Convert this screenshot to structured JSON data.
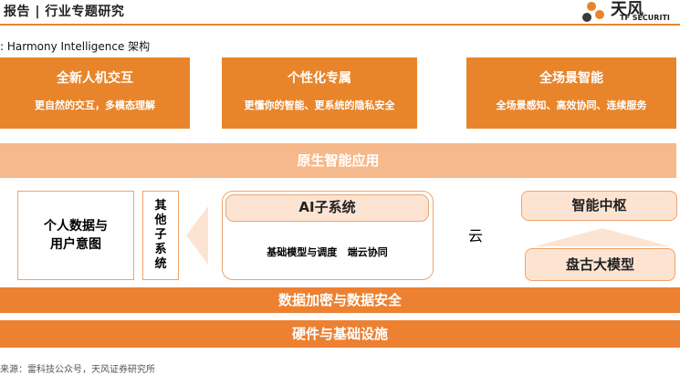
{
  "header": {
    "title": "报告 | 行业专题研究"
  },
  "logo": {
    "brand_cn": "天风",
    "brand_en": "TF SECURITI",
    "accent": "#e8852b",
    "dark": "#3a3a3a"
  },
  "figure": {
    "subtitle": ": Harmony Intelligence 架构"
  },
  "top_blocks": [
    {
      "title": "全新人机交互",
      "subtitle": "更自然的交互，多模态理解"
    },
    {
      "title": "个性化专属",
      "subtitle": "更懂你的智能、更系统的隐私安全"
    },
    {
      "title": "全场景智能",
      "subtitle": "全场景感知、高效协同、连续服务"
    }
  ],
  "native_layer": "原生智能应用",
  "personal_data": "个人数据与\n用户意图",
  "other_subsystems": "其\n他\n子\n系\n统",
  "ai_subsystem": {
    "title": "AI子系统",
    "content": "基础模型与调度   端云协同"
  },
  "cloud_label": "云",
  "intelligence_hub": "智能中枢",
  "pangu_model": "盘古大模型",
  "layers": {
    "security": "数据加密与数据安全",
    "hardware": "硬件与基础设施"
  },
  "source": "来源：雷科技公众号，天风证券研究所",
  "colors": {
    "orange": "#e8852b",
    "light_orange": "#f6b98b",
    "peach": "#fde4d2",
    "border": "#f0a36b"
  }
}
